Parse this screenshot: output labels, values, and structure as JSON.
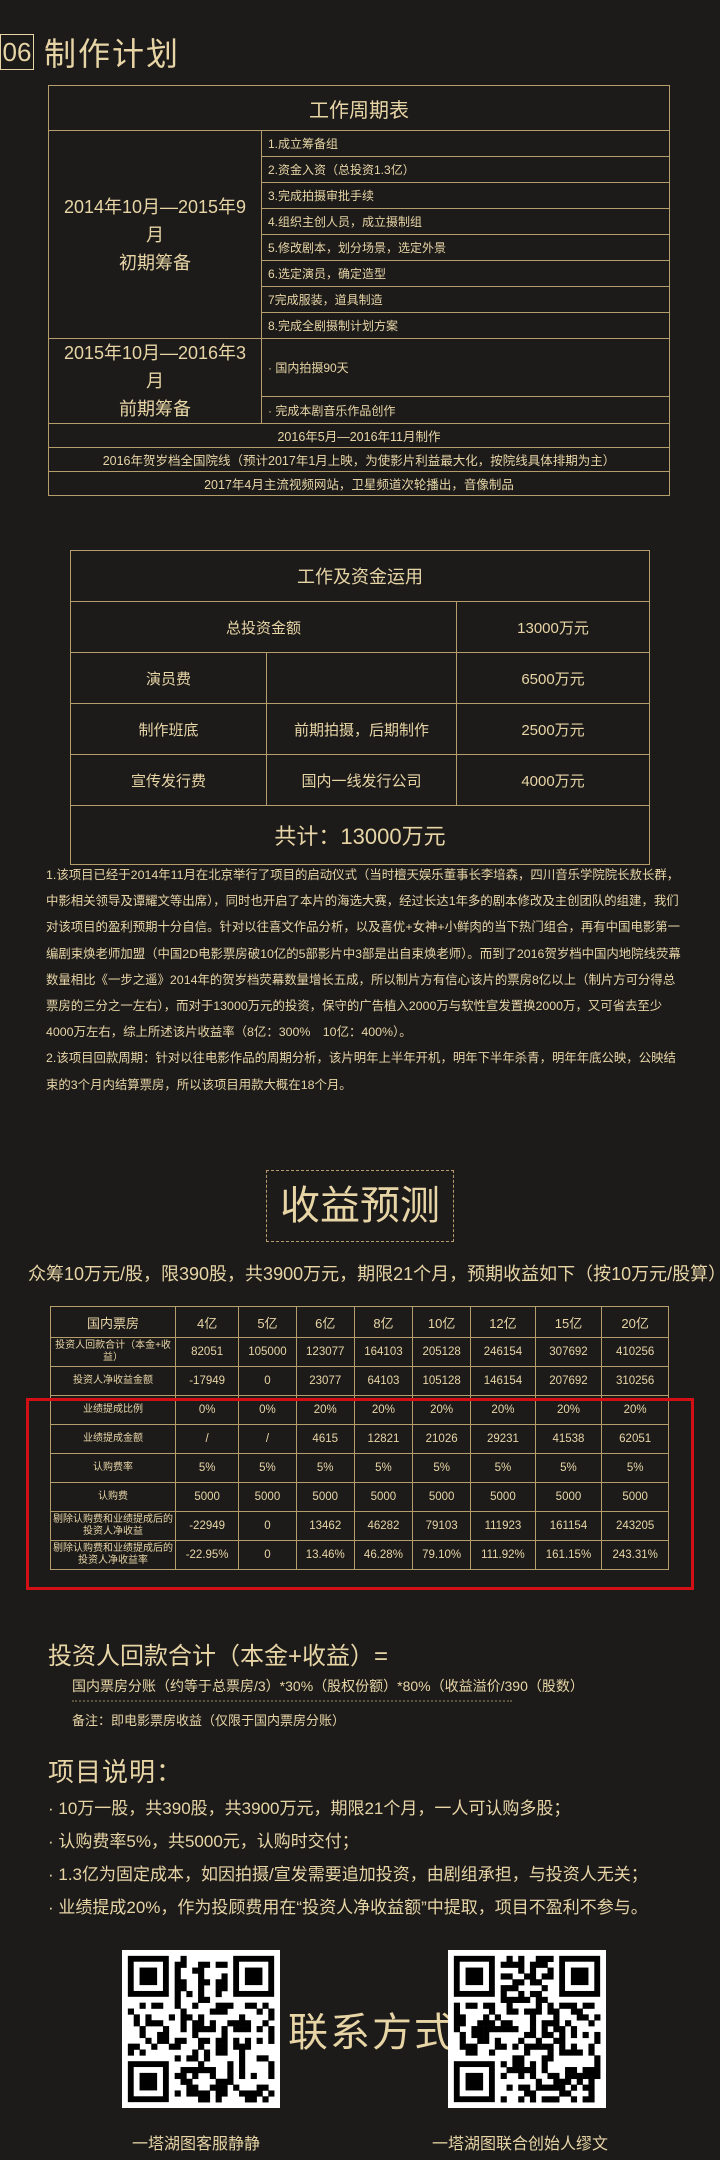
{
  "section": {
    "number": "06",
    "title": "制作计划"
  },
  "schedule": {
    "caption": "工作周期表",
    "phase1": {
      "line1": "2014年10月—2015年9月",
      "line2": "初期筹备"
    },
    "phase1_items": [
      "1.成立筹备组",
      "2.资金入资（总投资1.3亿）",
      "3.完成拍摄审批手续",
      "4.组织主创人员，成立摄制组",
      "5.修改剧本，划分场景，选定外景",
      "6.选定演员，确定造型",
      "7完成服装，道具制造",
      "8.完成全剧摄制计划方案"
    ],
    "phase2": {
      "line1": "2015年10月—2016年3月",
      "line2": "前期筹备"
    },
    "phase2_items": [
      "· 国内拍摄90天",
      "· 完成本剧音乐作品创作"
    ],
    "rows": [
      "2016年5月—2016年11月制作",
      "2016年贺岁档全国院线（预计2017年1月上映，为使影片利益最大化，按院线具体排期为主）",
      "2017年4月主流视频网站，卫星频道次轮播出，音像制品"
    ]
  },
  "funds": {
    "caption": "工作及资金运用",
    "total_label": "总投资金额",
    "total_value": "13000万元",
    "rows": [
      {
        "a": "演员费",
        "b": "",
        "c": "6500万元"
      },
      {
        "a": "制作班底",
        "b": "前期拍摄，后期制作",
        "c": "2500万元"
      },
      {
        "a": "宣传发行费",
        "b": "国内一线发行公司",
        "c": "4000万元"
      }
    ],
    "sum": "共计：13000万元"
  },
  "notes": {
    "p1": "1.该项目已经于2014年11月在北京举行了项目的启动仪式（当时檀天娱乐董事长李培森，四川音乐学院院长敖长群，中影相关领导及谭耀文等出席），同时也开启了本片的海选大赛，经过长达1年多的剧本修改及主创团队的组建，我们对该项目的盈利预期十分自信。针对以往喜文作品分析，以及喜优+女神+小鲜肉的当下热门组合，再有中国电影第一编剧束焕老师加盟（中国2D电影票房破10亿的5部影片中3部是出自束焕老师）。而到了2016贺岁档中国内地院线荧幕数量相比《一步之遥》2014年的贺岁档荧幕数量增长五成，所以制片方有信心该片的票房8亿以上（制片方可分得总票房的三分之一左右），而对于13000万元的投资，保守的广告植入2000万与软性宣发置换2000万，又可省去至少4000万左右，综上所述该片收益率（8亿：300%　10亿：400%）。",
    "p2": "2.该项目回款周期：针对以往电影作品的周期分析，该片明年上半年开机，明年下半年杀青，明年年底公映，公映结束的3个月内结算票房，所以该项目用款大概在18个月。"
  },
  "profit": {
    "title": "收益预测",
    "subtitle": "众筹10万元/股，限390股，共3900万元，期限21个月，预期收益如下（按10万元/股算）："
  },
  "returns": {
    "header": [
      "国内票房",
      "4亿",
      "5亿",
      "6亿",
      "8亿",
      "10亿",
      "12亿",
      "15亿",
      "20亿"
    ],
    "rows": [
      {
        "label": "投资人回款合计（本金+收益）",
        "values": [
          "82051",
          "105000",
          "123077",
          "164103",
          "205128",
          "246154",
          "307692",
          "410256"
        ]
      },
      {
        "label": "投资人净收益金额",
        "values": [
          "-17949",
          "0",
          "23077",
          "64103",
          "105128",
          "146154",
          "207692",
          "310256"
        ]
      },
      {
        "label": "业绩提成比例",
        "values": [
          "0%",
          "0%",
          "20%",
          "20%",
          "20%",
          "20%",
          "20%",
          "20%"
        ]
      },
      {
        "label": "业绩提成金额",
        "values": [
          "/",
          "/",
          "4615",
          "12821",
          "21026",
          "29231",
          "41538",
          "62051"
        ]
      },
      {
        "label": "认购费率",
        "values": [
          "5%",
          "5%",
          "5%",
          "5%",
          "5%",
          "5%",
          "5%",
          "5%"
        ]
      },
      {
        "label": "认购费",
        "values": [
          "5000",
          "5000",
          "5000",
          "5000",
          "5000",
          "5000",
          "5000",
          "5000"
        ]
      },
      {
        "label": "剔除认购费和业绩提成后的投资人净收益",
        "values": [
          "-22949",
          "0",
          "13462",
          "46282",
          "79103",
          "111923",
          "161154",
          "243205"
        ]
      },
      {
        "label": "剔除认购费和业绩提成后的投资人净收益率",
        "values": [
          "-22.95%",
          "0",
          "13.46%",
          "46.28%",
          "79.10%",
          "111.92%",
          "161.15%",
          "243.31%"
        ]
      }
    ]
  },
  "invest": {
    "title": "投资人回款合计（本金+收益）=",
    "formula": "国内票房分账（约等于总票房/3）*30%（股权份额）*80%（收益溢价/390（股数）",
    "note": "备注：即电影票房收益（仅限于国内票房分账）"
  },
  "explain": {
    "title": "项目说明：",
    "items": [
      "· 10万一股，共390股，共3900万元，期限21个月，一人可认购多股；",
      "· 认购费率5%，共5000元，认购时交付；",
      "· 1.3亿为固定成本，如因拍摄/宣发需要追加投资，由剧组承担，与投资人无关；",
      "· 业绩提成20%，作为投顾费用在“投资人净收益额”中提取，项目不盈利不参与。"
    ]
  },
  "contact": {
    "title": "联系方式",
    "left_caption": "一塔湖图客服静静",
    "right_caption": "一塔湖图联合创始人缪文"
  },
  "colors": {
    "gold": "#e8d5a6",
    "background": "#1c1b1a",
    "highlight": "#d10f14"
  }
}
